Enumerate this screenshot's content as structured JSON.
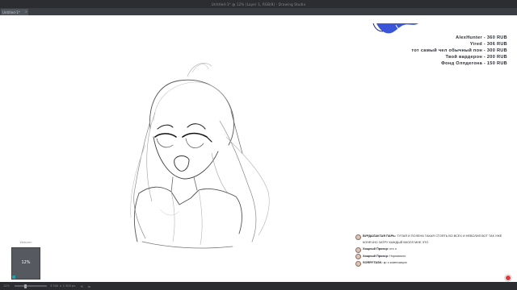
{
  "app": {
    "window_title": "Untitled-1* @ 12% (Layer 1, RGB/8) - Drawing Studio",
    "tab_label": "Untitled-1*"
  },
  "donations": [
    "AlexHunter - 360 RUB",
    "Yired - 306 RUB",
    "тот самый чел обычный пон - 300 RUB",
    "Твой вардерон - 200 RUB",
    "Фонд Олпдегона - 150 RUB"
  ],
  "progress_widget": {
    "label": "Webcam",
    "value_text": "12%",
    "fraction": 0.12
  },
  "chat": [
    {
      "user": "ВУРДАЛАКТАЯ ПАРЬ:",
      "text": "ТУПАЯ И ПОЛЕНА ТАКАЯ СТОЯТЬ ВО ВСЕХ И НЕВОЛИЛ ВОТ ТАК УЖЕ КОНЕЧНО ЗАТРУ КАЖДЫЙ ВКОЛЛ МНЕ ЭТО"
    },
    {
      "user": "Хищный Прохор:",
      "text": "кто о"
    },
    {
      "user": "Хищный Прохор:",
      "text": "Нормально"
    },
    {
      "user": "SORRYTASK:",
      "text": "кр о композиция"
    }
  ],
  "statusbar": {
    "zoom": "12%",
    "size_label": "3 500 × 2 500 px",
    "slider_level": 0.3
  },
  "colors": {
    "chrome_dark": "#2b2d31",
    "tab_strip": "#3a3d42",
    "progress_fill": "#20a0a8",
    "record": "#e23a3a",
    "mascot_blue": "#3a55d8"
  }
}
